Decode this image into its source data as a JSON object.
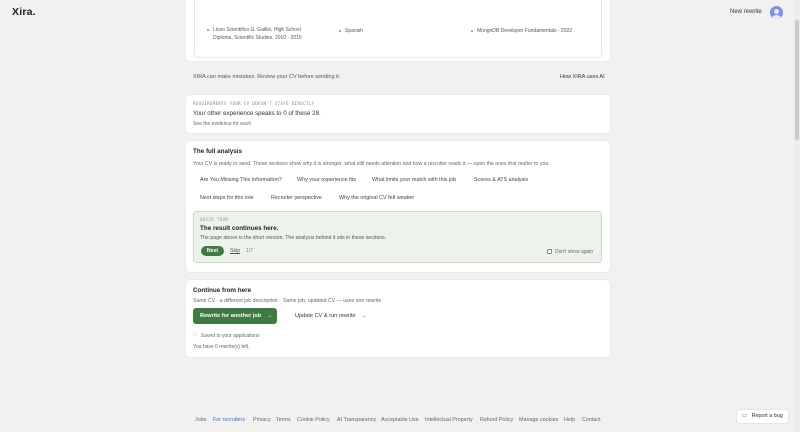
{
  "header": {
    "logo": "Xira.",
    "new_rewrite": "New rewrite"
  },
  "cv_preview": {
    "education": "Liceo Scientifico G. Galilei, High School Diploma, Scientific Studies, 2010 - 2015",
    "language": "Spanish",
    "certification": "MongoDB Developer Fundamentals - 2022"
  },
  "disclaimer": {
    "text": "XIRA can make mistakes. Review your CV before sending it.",
    "link": "How XIRA uses AI"
  },
  "requirements": {
    "label": "REQUIREMENTS YOUR CV DOESN'T STATE DIRECTLY",
    "main": "Your other experience speaks to 0 of these 28.",
    "sub": "See the evidence for each"
  },
  "full_analysis": {
    "title": "The full analysis",
    "description": "Your CV is ready to send. These sections show why it is stronger, what still needs attention and how a recruiter reads it — open the ones that matter to you.",
    "tabs": [
      "Are You Missing This Information?",
      "Why your experience fits",
      "What limits your match with this job",
      "Scores & ATS analysis",
      "Next steps for this role",
      "Recruiter perspective",
      "Why the original CV felt weaker"
    ]
  },
  "tour": {
    "label": "QUICK TOUR",
    "title": "The result continues here.",
    "description": "The page above is the short version. The analysis behind it sits in these sections.",
    "next": "Next",
    "skip": "Skip",
    "counter": "1/7",
    "dont_show": "Don't show again"
  },
  "continue": {
    "title": "Continue from here",
    "option_a": "Same CV · a different job description",
    "option_b": "Same job, updated CV — uses one rewrite",
    "rewrite_button": "Rewrite for another job",
    "update_button": "Update CV & run rewrite",
    "saved": "Saved to your applications",
    "rewrites_left": "You have 0 rewrite(s) left."
  },
  "footer": {
    "links": [
      "Jobs",
      "For recruiters",
      "Privacy",
      "Terms",
      "Cookie Policy",
      "AI Transparency",
      "Acceptable Use",
      "Intellectual Property",
      "Refund Policy",
      "Manage cookies",
      "Help",
      "Contact"
    ]
  },
  "report_bug": "Report a bug",
  "colors": {
    "accent_green": "#3f7a45",
    "link_blue": "#3b6fd8",
    "avatar": "#7d8fe6"
  }
}
